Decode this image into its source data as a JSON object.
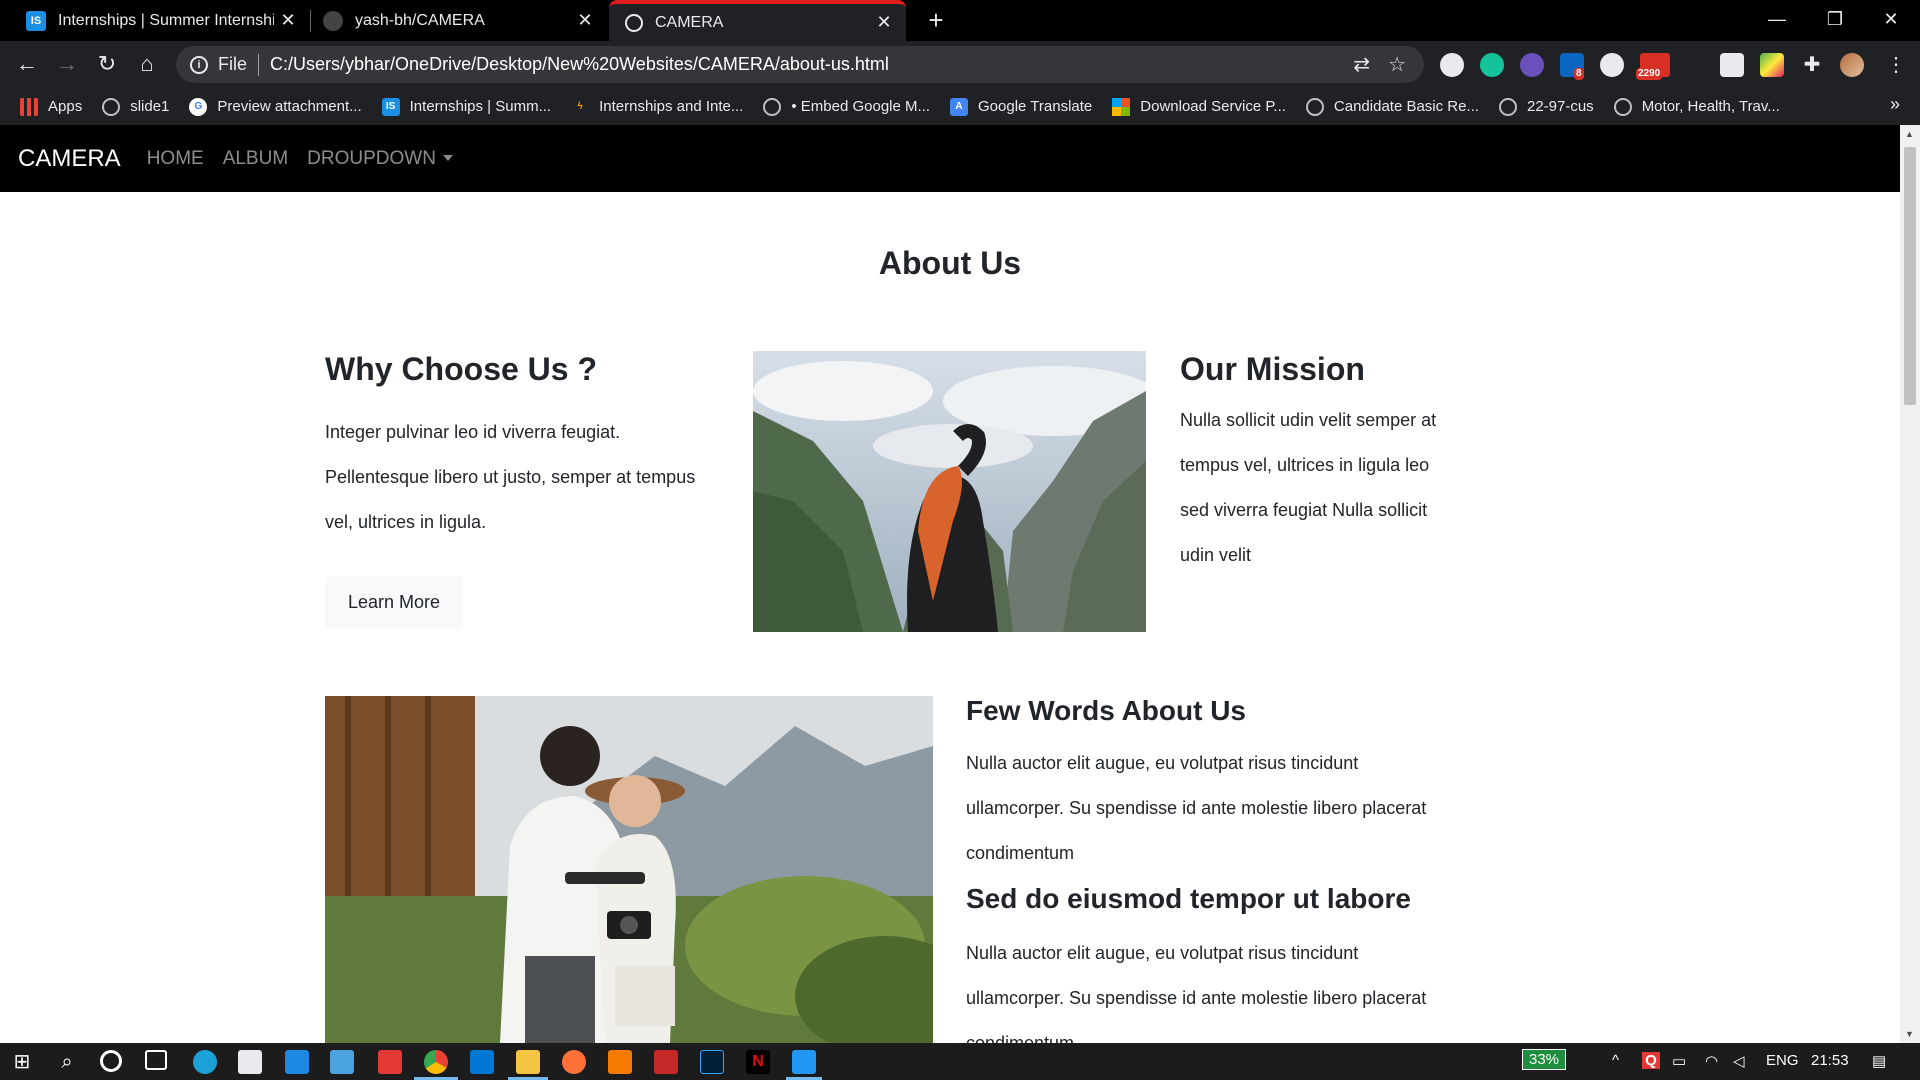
{
  "browser": {
    "tabs": [
      {
        "title": "Internships | Summer Internship",
        "favicon": "internshala-icon"
      },
      {
        "title": "yash-bh/CAMERA",
        "favicon": "github-icon"
      },
      {
        "title": "CAMERA",
        "favicon": "globe-icon"
      }
    ],
    "omnibox": {
      "scheme": "File",
      "url": "C:/Users/ybhar/OneDrive/Desktop/New%20Websites/CAMERA/about-us.html"
    },
    "bookmarks": [
      "Apps",
      "slide1",
      "Preview attachment...",
      "Internships | Summ...",
      "Internships and Inte...",
      "• Embed Google M...",
      "Google Translate",
      "Download Service P...",
      "Candidate Basic Re...",
      "22-97-cus",
      "Motor, Health, Trav..."
    ],
    "extension_badges": {
      "linkedin": "8",
      "mail": "2290"
    }
  },
  "site": {
    "brand": "CAMERA",
    "nav": [
      "HOME",
      "ALBUM",
      "DROUPDOWN"
    ],
    "page_title": "About Us",
    "why": {
      "heading": "Why Choose Us ?",
      "lines": [
        "Integer pulvinar leo id viverra feugiat.",
        "Pellentesque libero ut justo, semper at tempus",
        "vel, ultrices in ligula."
      ],
      "button": "Learn More"
    },
    "mission": {
      "heading": "Our Mission",
      "lines": [
        "Nulla sollicit udin velit semper at",
        "tempus vel, ultrices in ligula leo",
        "sed viverra feugiat Nulla sollicit",
        "udin velit"
      ]
    },
    "few_words": {
      "heading": "Few Words About Us",
      "lines": [
        "Nulla auctor elit augue, eu volutpat risus tincidunt",
        "ullamcorper. Su spendisse id ante molestie libero placerat",
        "condimentum"
      ]
    },
    "sed_do": {
      "heading": "Sed do eiusmod tempor ut labore",
      "lines": [
        "Nulla auctor elit augue, eu volutpat risus tincidunt",
        "ullamcorper. Su spendisse id ante molestie libero placerat",
        "condimentum"
      ]
    }
  },
  "taskbar": {
    "battery": "33%",
    "language": "ENG",
    "time": "21:53"
  },
  "colors": {
    "tab_accent": "#e01b1b",
    "chrome_bg": "#202124",
    "site_nav_bg": "#000000"
  }
}
